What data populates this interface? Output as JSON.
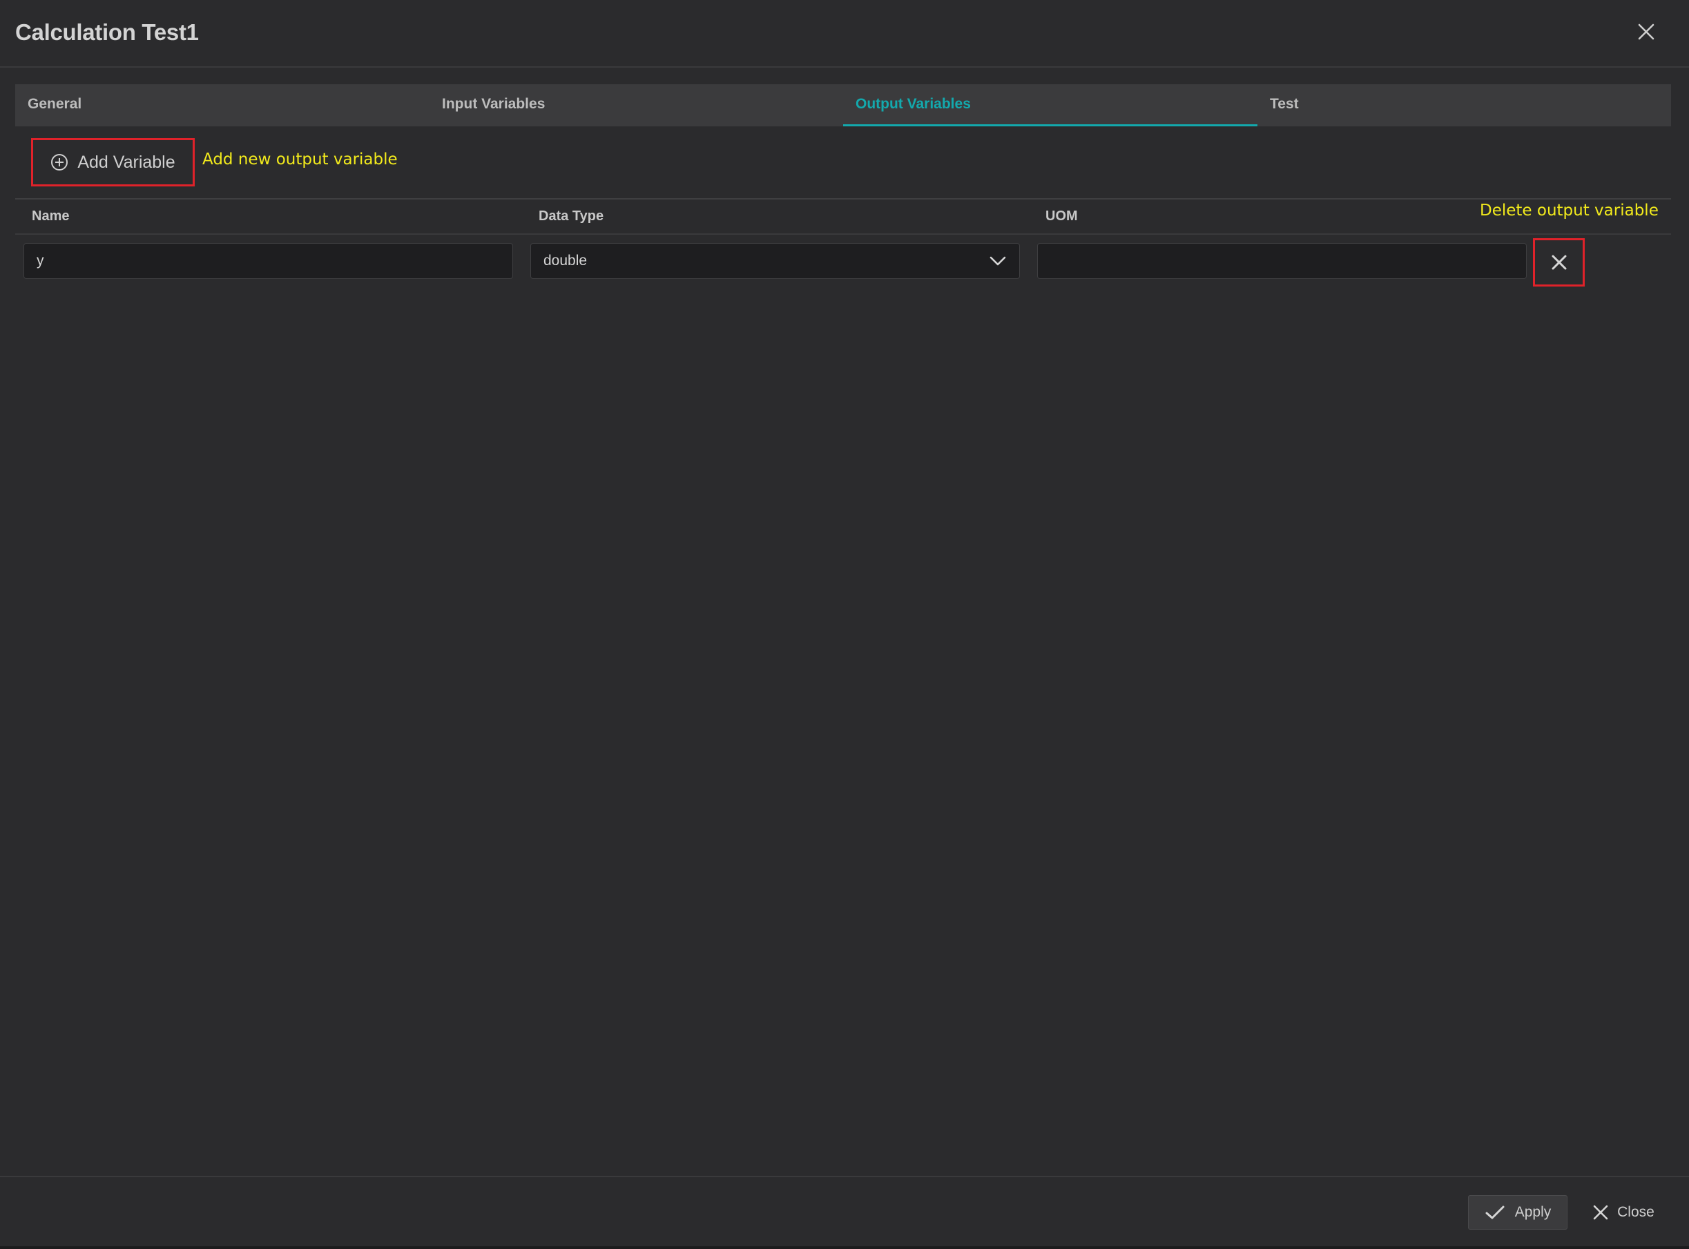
{
  "dialog": {
    "title": "Calculation Test1",
    "close_icon": "close-icon"
  },
  "tabs": [
    {
      "label": "General",
      "active": false
    },
    {
      "label": "Input Variables",
      "active": false
    },
    {
      "label": "Output Variables",
      "active": true
    },
    {
      "label": "Test",
      "active": false
    }
  ],
  "toolbar": {
    "add_label": "Add Variable",
    "add_icon": "plus-circle-icon"
  },
  "annotations": {
    "add_note": "Add new output variable",
    "delete_note": "Delete output variable"
  },
  "table": {
    "columns": [
      "Name",
      "Data Type",
      "UOM"
    ],
    "rows": [
      {
        "name": "y",
        "data_type": "double",
        "uom": ""
      }
    ]
  },
  "footer": {
    "apply_label": "Apply",
    "close_label": "Close"
  },
  "colors": {
    "background": "#2b2b2d",
    "accent": "#13a9ad",
    "annotation_box": "#e0222a",
    "annotation_text": "#f2ea1c"
  }
}
